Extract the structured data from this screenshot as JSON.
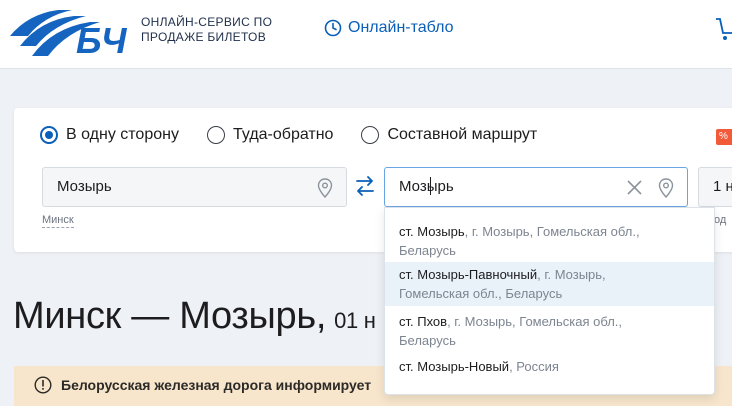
{
  "header": {
    "logo_mark": "БЧ",
    "logo_text_line1": "ОНЛАЙН-СЕРВИС ПО",
    "logo_text_line2": "ПРОДАЖЕ БИЛЕТОВ",
    "tablo_label": "Онлайн-табло",
    "icons": {
      "tablo": "clock-icon",
      "cart": "cart-icon"
    }
  },
  "search": {
    "trip_types": [
      {
        "label": "В одну сторону",
        "checked": true
      },
      {
        "label": "Туда-обратно",
        "checked": false
      },
      {
        "label": "Составной маршрут",
        "checked": false
      }
    ],
    "promo_badge": "%",
    "from_value": "Мозырь",
    "from_hint": "Минск",
    "to_value": "Мозырь",
    "date_value": "1 н",
    "date_hint": "од"
  },
  "suggestions": [
    {
      "main": "ст. Мозырь",
      "sub": ", г. Мозырь, Гомельская обл.,",
      "line2": "Беларусь",
      "highlighted": false
    },
    {
      "main": "ст. Мозырь-Павночный",
      "sub": ", г. Мозырь,",
      "line2": "Гомельская обл., Беларусь",
      "highlighted": true
    },
    {
      "main": "ст. Пхов",
      "sub": ", г. Мозырь, Гомельская обл.,",
      "line2": "Беларусь",
      "highlighted": false
    },
    {
      "main": "ст. Мозырь-Новый",
      "sub": ", Россия",
      "line2": "",
      "highlighted": false
    }
  ],
  "page": {
    "title": "Минск — Мозырь,",
    "title_date": "01 н"
  },
  "info": {
    "text": "Белорусская железная дорога информирует"
  },
  "colors": {
    "brand_blue": "#0a5fb8",
    "logo_blue": "#1565c0",
    "info_bg": "#f7e6cc",
    "highlight": "#e9f1f9"
  }
}
